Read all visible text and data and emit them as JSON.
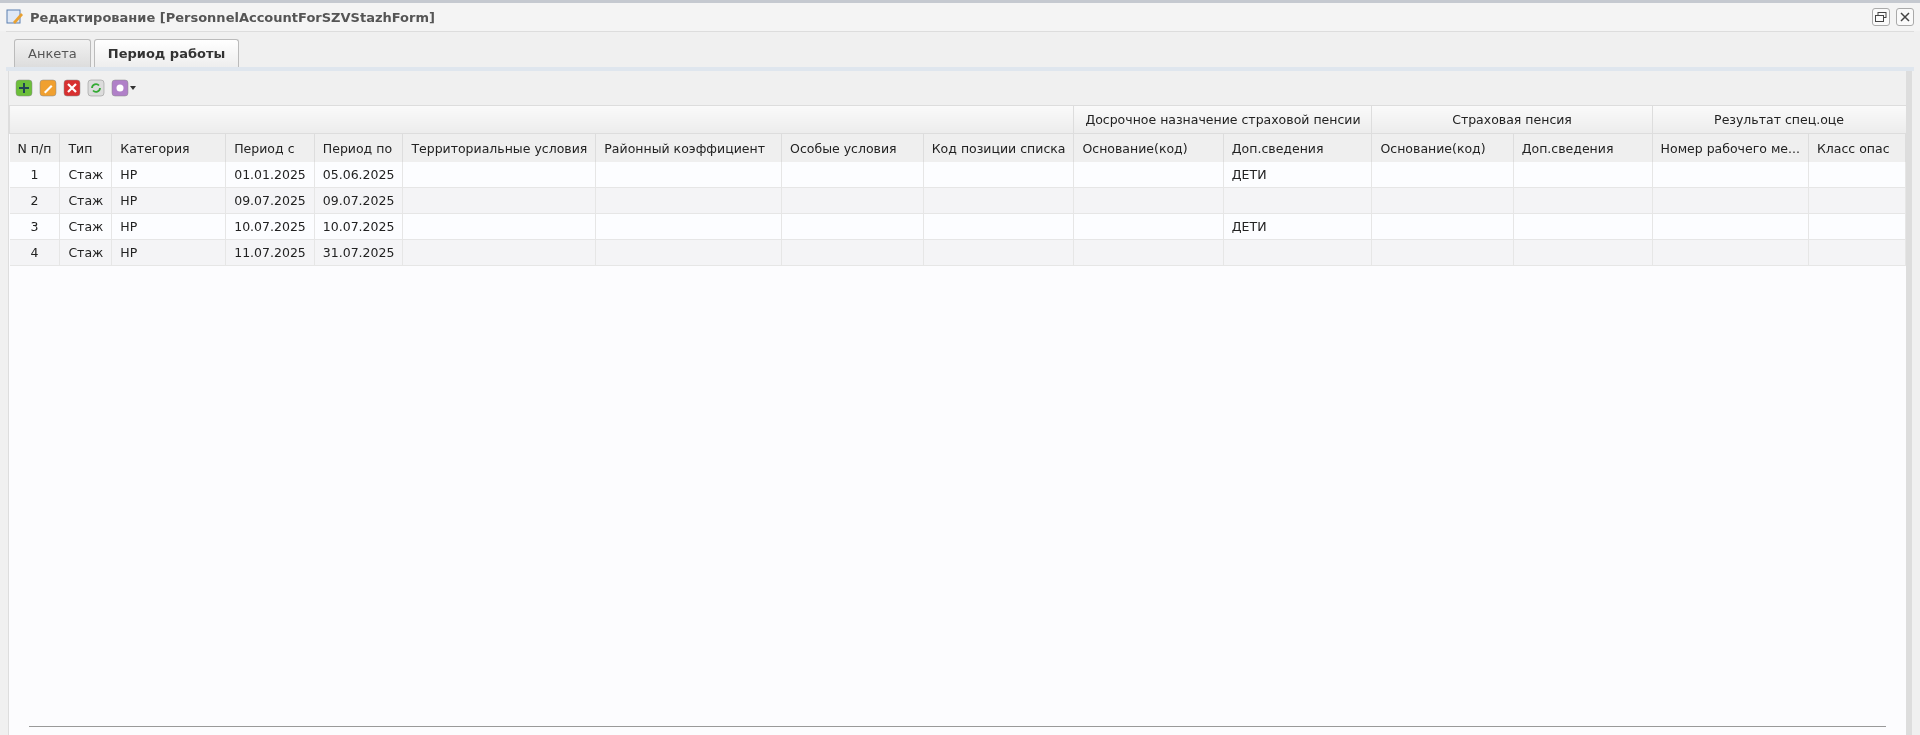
{
  "window": {
    "title": "Редактирование [PersonnelAccountForSZVStazhForm]"
  },
  "tabs": [
    {
      "label": "Анкета",
      "selected": false
    },
    {
      "label": "Период работы",
      "selected": true
    }
  ],
  "toolbar": [
    {
      "kind": "add"
    },
    {
      "kind": "edit"
    },
    {
      "kind": "delete"
    },
    {
      "kind": "refresh"
    },
    {
      "kind": "settings"
    }
  ],
  "table": {
    "column_groups": [
      "Досрочное назначение страховой пенсии",
      "Страховая пенсия",
      "Результат спец.оце"
    ],
    "columns": [
      "N п/п",
      "Тип",
      "Категория",
      "Период с",
      "Период по",
      "Территориальные условия",
      "Районный коэффициент",
      "Особые условия",
      "Код позиции списка",
      "Основание(код)",
      "Доп.сведения",
      "Основание(код)",
      "Доп.сведения",
      "Номер рабочего ме...",
      "Класс опас"
    ],
    "rows": [
      [
        "1",
        "Стаж",
        "НР",
        "01.01.2025",
        "05.06.2025",
        "",
        "",
        "",
        "",
        "",
        "ДЕТИ",
        "",
        "",
        "",
        ""
      ],
      [
        "2",
        "Стаж",
        "НР",
        "09.07.2025",
        "09.07.2025",
        "",
        "",
        "",
        "",
        "",
        "",
        "",
        "",
        "",
        ""
      ],
      [
        "3",
        "Стаж",
        "НР",
        "10.07.2025",
        "10.07.2025",
        "",
        "",
        "",
        "",
        "",
        "ДЕТИ",
        "",
        "",
        "",
        ""
      ],
      [
        "4",
        "Стаж",
        "НР",
        "11.07.2025",
        "31.07.2025",
        "",
        "",
        "",
        "",
        "",
        "",
        "",
        "",
        "",
        ""
      ]
    ]
  }
}
